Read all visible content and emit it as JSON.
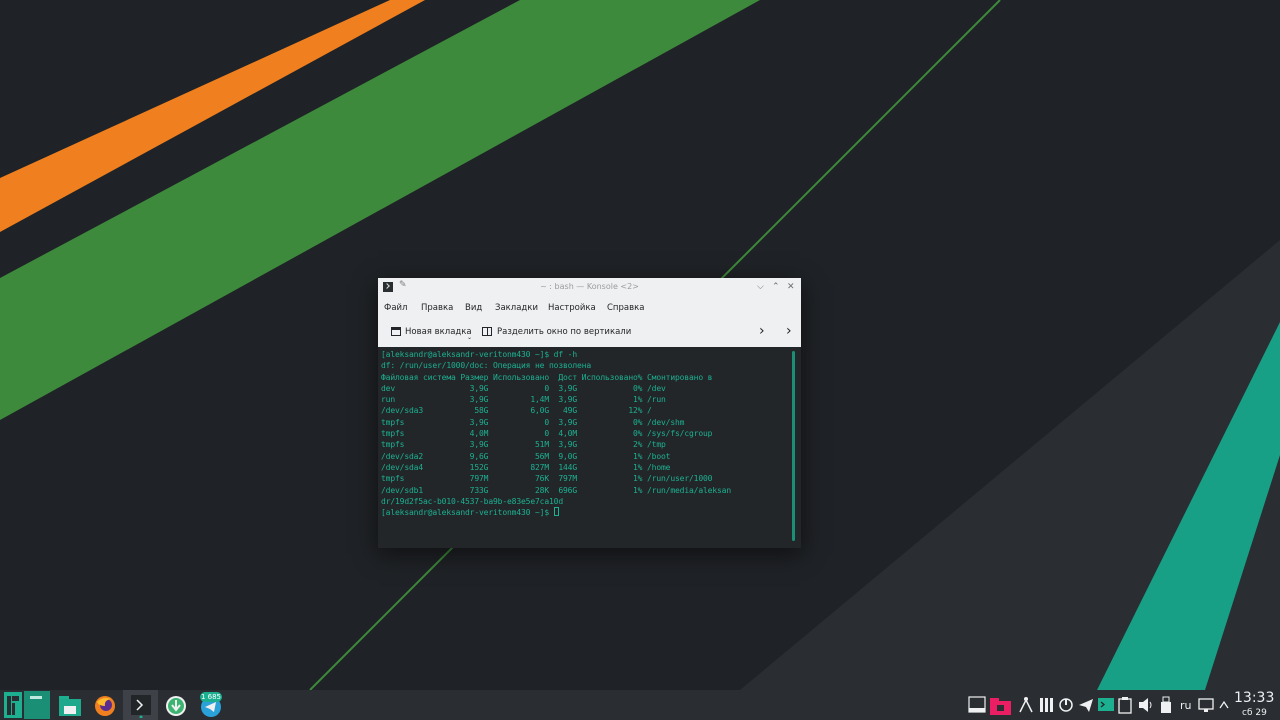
{
  "colors": {
    "accent": "#1cb091",
    "orange": "#f08020",
    "green": "#3e8a3c",
    "panel": "#2a2e32"
  },
  "window": {
    "title": "~ : bash — Konsole <2>",
    "menu": [
      "Файл",
      "Правка",
      "Вид",
      "Закладки",
      "Настройка",
      "Справка"
    ],
    "toolbar": {
      "new_tab": "Новая вкладка",
      "split": "Разделить окно по вертикали"
    }
  },
  "terminal": {
    "lines": [
      "[aleksandr@aleksandr-veritonm430 ~]$ df -h",
      "df: /run/user/1000/doc: Операция не позволена",
      "Файловая система Размер Использовано  Дост Использовано% Смонтировано в",
      "dev                3,9G            0  3,9G            0% /dev",
      "run                3,9G         1,4M  3,9G            1% /run",
      "/dev/sda3           58G         6,0G   49G           12% /",
      "tmpfs              3,9G            0  3,9G            0% /dev/shm",
      "tmpfs              4,0M            0  4,0M            0% /sys/fs/cgroup",
      "tmpfs              3,9G          51M  3,9G            2% /tmp",
      "/dev/sda2          9,6G          56M  9,0G            1% /boot",
      "/dev/sda4          152G         827M  144G            1% /home",
      "tmpfs              797M          76K  797M            1% /run/user/1000",
      "/dev/sdb1          733G          28K  696G            1% /run/media/aleksan",
      "dr/19d2f5ac-b010-4537-ba9b-e83e5e7ca10d"
    ],
    "prompt": "[aleksandr@aleksandr-veritonm430 ~]$ "
  },
  "taskbar": {
    "badge": "1 685",
    "lang": "ru",
    "time": "13:33",
    "date": "сб 29"
  },
  "icons": [
    "manjaro-menu-icon",
    "pager-icon",
    "files-icon",
    "firefox-icon",
    "konsole-icon",
    "updates-icon",
    "telegram-icon",
    "show-desktop-icon",
    "folder-icon",
    "kdeconnect-icon",
    "tray-settings-icon",
    "power-icon",
    "send-icon",
    "terminal-tray-icon",
    "clipboard-icon",
    "volume-icon",
    "usb-icon",
    "display-icon",
    "expand-tray-icon"
  ]
}
